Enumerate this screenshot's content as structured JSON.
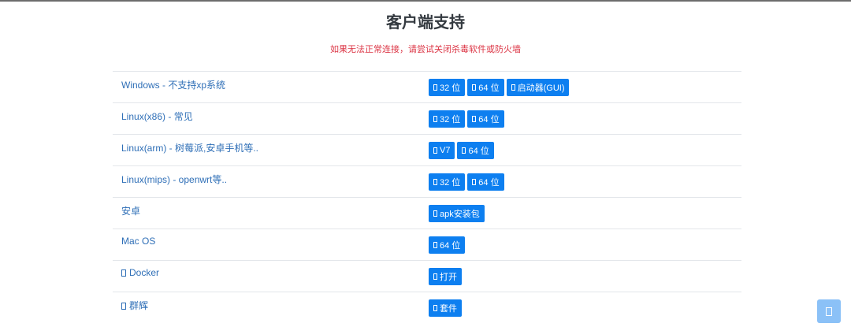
{
  "header": {
    "title": "客户端支持",
    "notice": "如果无法正常连接，请尝试关闭杀毒软件或防火墙"
  },
  "rows": [
    {
      "name": "Windows - 不支持xp系统",
      "icon": null,
      "buttons": [
        {
          "label": "32 位",
          "icon": "download-icon"
        },
        {
          "label": "64 位",
          "icon": "download-icon"
        },
        {
          "label": "启动器(GUI)",
          "icon": "download-icon"
        }
      ]
    },
    {
      "name": "Linux(x86) - 常见",
      "icon": null,
      "buttons": [
        {
          "label": "32 位",
          "icon": "download-icon"
        },
        {
          "label": "64 位",
          "icon": "download-icon"
        }
      ]
    },
    {
      "name": "Linux(arm) - 树莓派,安卓手机等..",
      "icon": null,
      "buttons": [
        {
          "label": "V7",
          "icon": "download-icon"
        },
        {
          "label": "64 位",
          "icon": "download-icon"
        }
      ]
    },
    {
      "name": "Linux(mips) - openwrt等..",
      "icon": null,
      "buttons": [
        {
          "label": "32 位",
          "icon": "download-icon"
        },
        {
          "label": "64 位",
          "icon": "download-icon"
        }
      ]
    },
    {
      "name": "安卓",
      "icon": null,
      "buttons": [
        {
          "label": "apk安装包",
          "icon": "download-icon"
        }
      ]
    },
    {
      "name": "Mac OS",
      "icon": null,
      "buttons": [
        {
          "label": "64 位",
          "icon": "download-icon"
        }
      ]
    },
    {
      "name": "Docker",
      "icon": "docker-icon",
      "buttons": [
        {
          "label": "打开",
          "icon": "external-link-icon"
        }
      ]
    },
    {
      "name": "群辉",
      "icon": "synology-icon",
      "buttons": [
        {
          "label": "套件",
          "icon": "package-icon"
        }
      ]
    }
  ],
  "floating_button": {
    "icon": "chat-icon"
  },
  "colors": {
    "accent": "#0d7ff0",
    "link": "#2f6fb7",
    "warning": "#dc3545"
  }
}
